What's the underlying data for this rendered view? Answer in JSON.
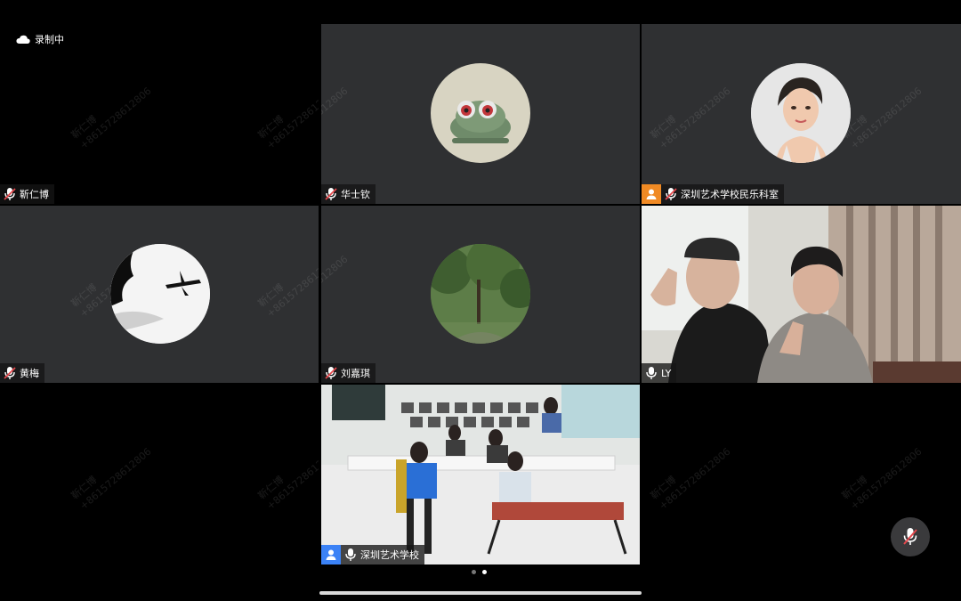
{
  "recording": {
    "label": "录制中",
    "icon": "cloud-icon"
  },
  "watermark": {
    "name": "靳仁博",
    "phone": "+8615728612806"
  },
  "participants": [
    {
      "name": "靳仁博",
      "mic": "muted",
      "video": "off"
    },
    {
      "name": "华士钦",
      "mic": "muted",
      "video": "avatar"
    },
    {
      "name": "深圳艺术学校民乐科室",
      "mic": "muted",
      "video": "avatar",
      "badge": "host"
    },
    {
      "name": "黄梅",
      "mic": "muted",
      "video": "avatar"
    },
    {
      "name": "刘嘉琪",
      "mic": "muted",
      "video": "avatar"
    },
    {
      "name": "LY",
      "mic": "on",
      "video": "on",
      "active_speaker": true
    },
    {
      "name": "深圳艺术学校",
      "mic": "on",
      "video": "on",
      "badge": "co-host"
    }
  ],
  "pagination": {
    "pages": 2,
    "current": 2
  },
  "colors": {
    "tile": "#2f3032",
    "active_border": "#3fbf6b",
    "host_badge": "#3b82f6",
    "cohost_badge": "#f08a24"
  }
}
